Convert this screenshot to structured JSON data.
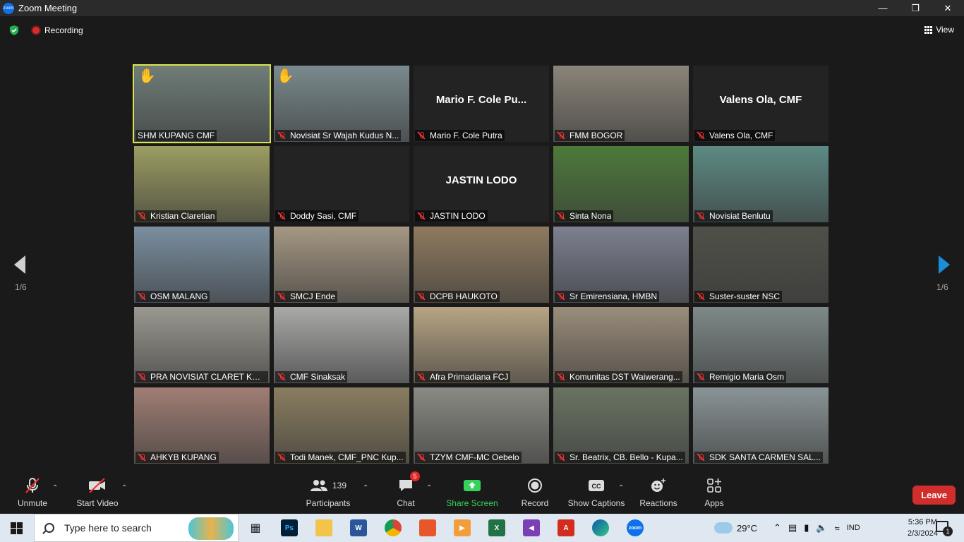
{
  "window": {
    "title": "Zoom Meeting",
    "app_icon": "zoom-logo-icon"
  },
  "topbar": {
    "recording_label": "Recording",
    "view_label": "View",
    "shield_color": "#23b14d"
  },
  "gallery": {
    "page_left": "1/6",
    "page_right": "1/6",
    "tiles": [
      {
        "name": "SHM KUPANG CMF",
        "hand": true,
        "bg": "#6f7d78"
      },
      {
        "name": "Novisiat Sr Wajah Kudus N...",
        "hand": true,
        "bg": "#7a8a8e"
      },
      {
        "name": "Mario F. Cole Putra",
        "big": "Mario  F. Cole Pu..."
      },
      {
        "name": "FMM BOGOR",
        "bg": "#8b8478"
      },
      {
        "name": "Valens Ola, CMF",
        "big": "Valens Ola, CMF"
      },
      {
        "name": "Kristian Claretian",
        "bg": "#9c9c62"
      },
      {
        "name": "Doddy Sasi, CMF"
      },
      {
        "name": "JASTIN LODO",
        "big": "JASTIN LODO"
      },
      {
        "name": "Sinta Nona",
        "bg": "#4d7a3a"
      },
      {
        "name": "Novisiat Benlutu",
        "bg": "#5d8a84"
      },
      {
        "name": "OSM MALANG",
        "bg": "#7a8fa0"
      },
      {
        "name": "SMCJ Ende",
        "bg": "#a59884"
      },
      {
        "name": "DCPB HAUKOTO",
        "bg": "#8e7a5e"
      },
      {
        "name": "Sr Emirensiana, HMBN",
        "bg": "#7c8090"
      },
      {
        "name": "Suster-suster NSC",
        "bg": "#4e5048"
      },
      {
        "name": "PRA NOVISIAT CLARET KUP...",
        "bg": "#9a9890"
      },
      {
        "name": "CMF Sinaksak",
        "bg": "#a9aaa8"
      },
      {
        "name": "Afra Primadiana FCJ",
        "bg": "#b7a483"
      },
      {
        "name": "Komunitas DST Waiwerang...",
        "bg": "#9a8d7a"
      },
      {
        "name": "Remigio Maria Osm",
        "bg": "#7e8a88"
      },
      {
        "name": "AHKYB KUPANG",
        "bg": "#a07e74"
      },
      {
        "name": "Todi Manek, CMF_PNC Kup...",
        "bg": "#8a7d60"
      },
      {
        "name": "TZYM CMF-MC Oebelo",
        "bg": "#8a8a84"
      },
      {
        "name": "Sr. Beatrix, CB. Bello - Kupa...",
        "bg": "#6a7462"
      },
      {
        "name": "SDK  SANTA CARMEN SAL...",
        "bg": "#8a9496"
      }
    ]
  },
  "toolbar": {
    "unmute": "Unmute",
    "start_video": "Start Video",
    "participants": "Participants",
    "participants_count": "139",
    "chat": "Chat",
    "chat_badge": "5",
    "share_screen": "Share Screen",
    "record": "Record",
    "show_captions": "Show Captions",
    "reactions": "Reactions",
    "apps": "Apps",
    "leave": "Leave",
    "share_color": "#35d35a",
    "leave_color": "#d12d2d"
  },
  "taskbar": {
    "search_placeholder": "Type here to search",
    "temperature": "29°C",
    "language": "IND",
    "time": "5:36 PM",
    "date": "2/3/2024",
    "notification_count": "1"
  }
}
